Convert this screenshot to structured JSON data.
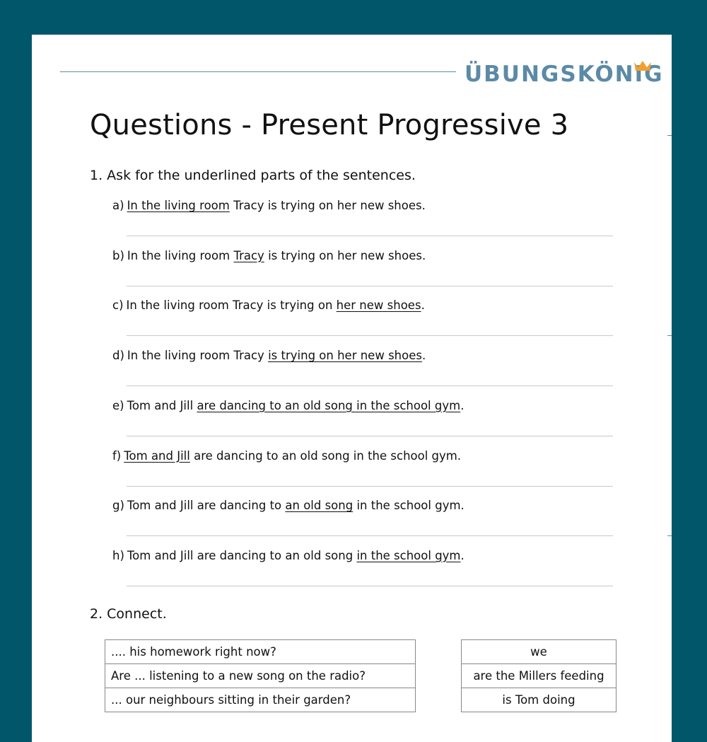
{
  "brand": {
    "logo_text": "ÜBUNGSKÖNIG",
    "logo_color": "#5b8aa6",
    "crown_color": "#f0a030",
    "background_color": "#02566a"
  },
  "title": "Questions - Present Progressive 3",
  "task1": {
    "heading": "1. Ask for the underlined parts of the sentences.",
    "items": [
      {
        "label": "a)",
        "before": "",
        "underlined": "In the living room",
        "after": " Tracy is trying on her new shoes."
      },
      {
        "label": "b)",
        "before": "In the living room ",
        "underlined": "Tracy",
        "after": " is trying on her new shoes."
      },
      {
        "label": "c)",
        "before": "In the living room Tracy is trying on ",
        "underlined": "her new shoes",
        "after": "."
      },
      {
        "label": "d)",
        "before": "In the living room Tracy ",
        "underlined": "is trying on her new shoes",
        "after": "."
      },
      {
        "label": "e)",
        "before": "Tom and Jill ",
        "underlined": "are dancing to an old song in the school gym",
        "after": "."
      },
      {
        "label": "f)",
        "before": "",
        "underlined": "Tom and Jill",
        "after": " are dancing to an old song in the school gym."
      },
      {
        "label": "g)",
        "before": "Tom and Jill are dancing to ",
        "underlined": "an old song",
        "after": " in the school gym."
      },
      {
        "label": "h)",
        "before": "Tom and Jill are dancing to an old song ",
        "underlined": "in the school gym",
        "after": "."
      }
    ]
  },
  "task2": {
    "heading": "2. Connect.",
    "left": [
      ".... his homework right now?",
      "Are ... listening to a new song on the radio?",
      "... our neighbours sitting in their garden?"
    ],
    "right": [
      "we",
      "are the Millers feeding",
      "is Tom doing"
    ]
  }
}
